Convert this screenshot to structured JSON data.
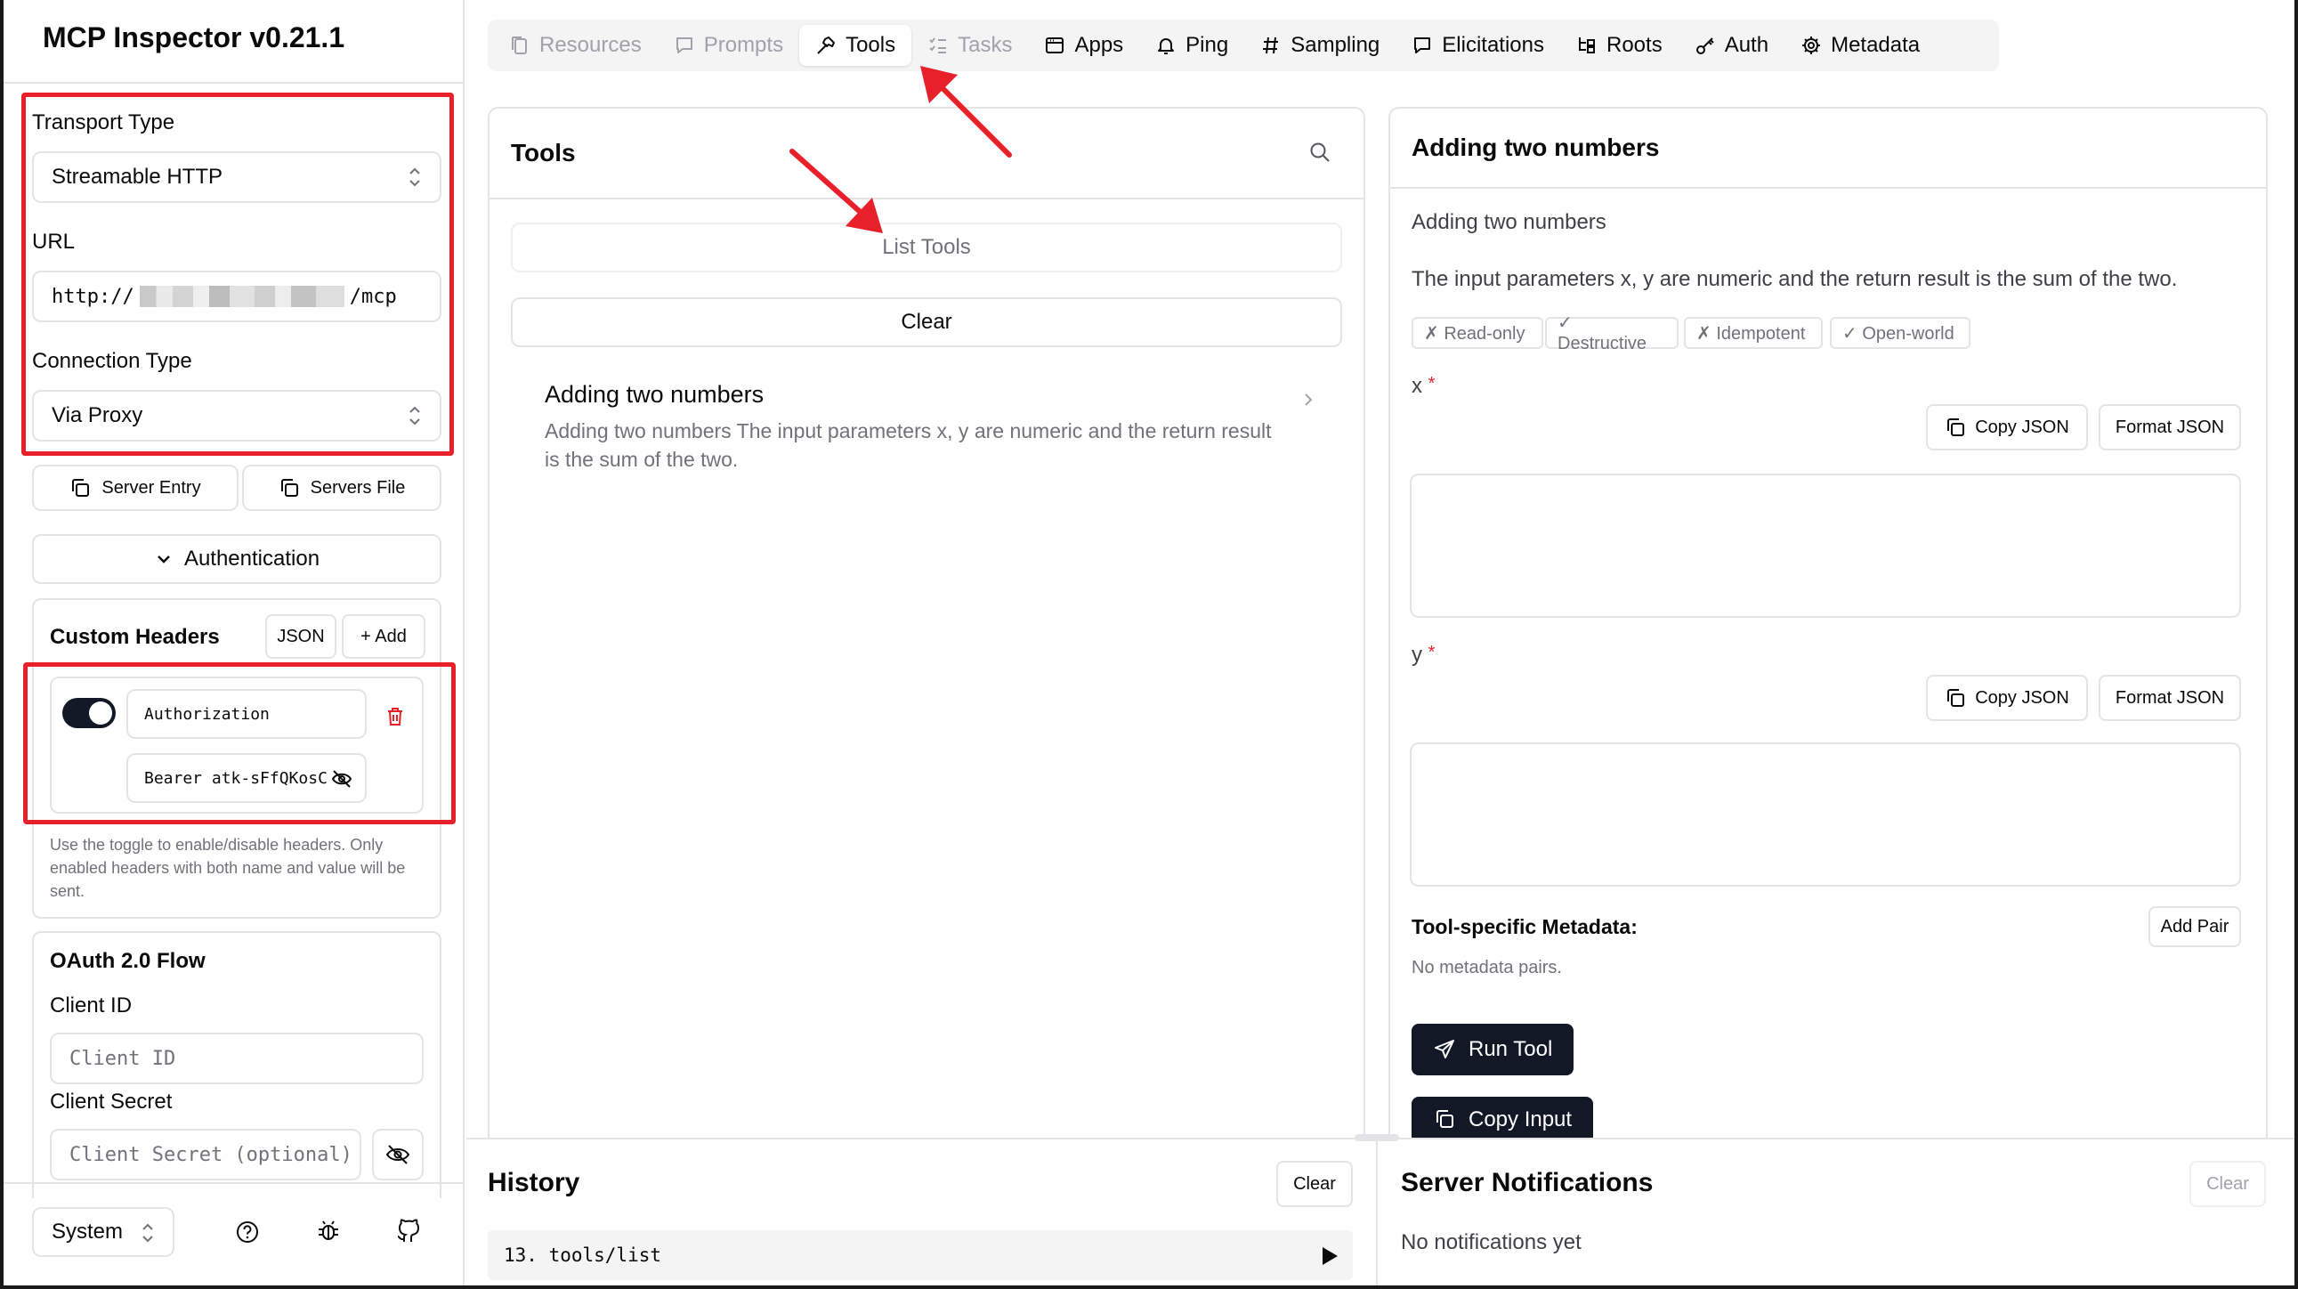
{
  "sidebar": {
    "title": "MCP Inspector v0.21.1",
    "transport_label": "Transport Type",
    "transport_value": "Streamable HTTP",
    "url_label": "URL",
    "url_prefix": "http://",
    "url_suffix": "/mcp",
    "connection_label": "Connection Type",
    "connection_value": "Via Proxy",
    "server_entry": "Server Entry",
    "servers_file": "Servers File",
    "authentication": "Authentication",
    "custom_headers": {
      "title": "Custom Headers",
      "json_btn": "JSON",
      "add_btn": "+ Add",
      "header_name": "Authorization",
      "header_value": "Bearer atk-sFfQKosC",
      "enabled": true,
      "help": "Use the toggle to enable/disable headers. Only enabled headers with both name and value will be sent."
    },
    "oauth": {
      "title": "OAuth 2.0 Flow",
      "client_id_label": "Client ID",
      "client_id_placeholder": "Client ID",
      "client_secret_label": "Client Secret",
      "client_secret_placeholder": "Client Secret (optional)"
    },
    "theme_value": "System"
  },
  "tabs": [
    {
      "label": "Resources",
      "icon": "files-icon",
      "state": "disabled"
    },
    {
      "label": "Prompts",
      "icon": "message-icon",
      "state": "disabled"
    },
    {
      "label": "Tools",
      "icon": "hammer-icon",
      "state": "active"
    },
    {
      "label": "Tasks",
      "icon": "list-checks-icon",
      "state": "disabled"
    },
    {
      "label": "Apps",
      "icon": "app-window-icon",
      "state": "normal"
    },
    {
      "label": "Ping",
      "icon": "bell-icon",
      "state": "normal"
    },
    {
      "label": "Sampling",
      "icon": "hash-icon",
      "state": "normal"
    },
    {
      "label": "Elicitations",
      "icon": "message-square-icon",
      "state": "normal"
    },
    {
      "label": "Roots",
      "icon": "folder-tree-icon",
      "state": "normal"
    },
    {
      "label": "Auth",
      "icon": "key-icon",
      "state": "normal"
    },
    {
      "label": "Metadata",
      "icon": "gear-icon",
      "state": "normal"
    }
  ],
  "tools_panel": {
    "title": "Tools",
    "list_tools": "List Tools",
    "clear": "Clear",
    "items": [
      {
        "name": "Adding two numbers",
        "description": "Adding two numbers The input parameters x, y are numeric and the return result is the sum of the two."
      }
    ]
  },
  "detail": {
    "title": "Adding two numbers",
    "subtitle": "Adding two numbers",
    "description": "The input parameters x, y are numeric and the return result is the sum of the two.",
    "badges": [
      "✗ Read-only",
      "✓ Destructive",
      "✗ Idempotent",
      "✓ Open-world"
    ],
    "param_x": "x",
    "param_y": "y",
    "required_mark": "*",
    "copy_json": "Copy JSON",
    "format_json": "Format JSON",
    "metadata_title": "Tool-specific Metadata:",
    "add_pair": "Add Pair",
    "no_metadata": "No metadata pairs.",
    "run_tool": "Run Tool",
    "copy_input": "Copy Input"
  },
  "history": {
    "title": "History",
    "clear": "Clear",
    "entry": "13. tools/list"
  },
  "notifications": {
    "title": "Server Notifications",
    "clear": "Clear",
    "empty": "No notifications yet"
  },
  "colors": {
    "annotation_red": "#e8202a",
    "dark_button": "#121826",
    "border": "#e4e4e7",
    "muted": "#71717a"
  }
}
